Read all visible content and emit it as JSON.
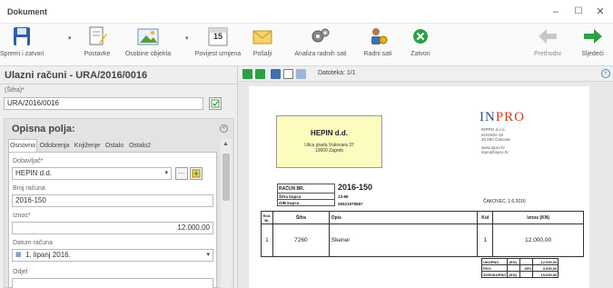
{
  "window": {
    "title": "Dokument"
  },
  "toolbar": {
    "save_close": "Spremi i zatvori",
    "settings": "Postavke",
    "personal_objects": "Osobine objekta",
    "change_history": "Povijest izmjena",
    "send": "Pošalji",
    "work_hours_analysis": "Analiza radnih sati",
    "work_hours": "Radni sati",
    "close": "Zatvori",
    "previous": "Prethodni",
    "next": "Sljedeći",
    "history_badge": "15"
  },
  "left": {
    "title": "Ulazni računi - URA/2016/0016",
    "code_label": "(Šifra)*",
    "code_value": "URA/2016/0016",
    "section_title": "Opisna polja:",
    "tabs": [
      "Osnovno",
      "Odobrenja",
      "Knjiženje",
      "Ostalo",
      "Ostalo2"
    ],
    "supplier_label": "Dobavljač*",
    "supplier_value": "HEPIN d.d.",
    "invoice_no_label": "Broj računa",
    "invoice_no_value": "2016-150",
    "amount_label": "Iznos*",
    "amount_value": "12.000,00",
    "date_label": "Datum računa",
    "date_value": "1. lipanj 2016.",
    "department_label": "Odjel"
  },
  "viewer": {
    "files_label": "Datoteka: 1/1"
  },
  "invoice": {
    "supplier_name": "HEPIN d.d.",
    "supplier_address_1": "Ulica grada Vukovara 37",
    "supplier_address_2": "10000 Zagreb",
    "logo_in": "IN",
    "logo_pro": "PRO",
    "company_line_1": "INPRO d.o.o.",
    "company_line_2": "M.Krleže 28",
    "company_line_3": "40 000 Čakovec",
    "company_line_4": "www.inpro.hr",
    "company_line_5": "inpro@inpro.hr",
    "racun_label": "RAČUN BR.",
    "racun_value": "2016-150",
    "sifra_kupca_label": "Šifra kupca",
    "sifra_kupca_value": "13-89",
    "oib_label": "OIB kupca",
    "oib_value": "26521978587",
    "place_date": "ČAKOVEC, 1.6.2016",
    "columns": [
      "Red. Br.",
      "Šifra",
      "Opis",
      "Kol",
      "Iznos (KN)"
    ],
    "rows": [
      {
        "no": "1",
        "code": "7260",
        "desc": "Skener",
        "qty": "1",
        "amount": "12.000,00"
      }
    ],
    "totals": [
      {
        "label": "UKUPNO",
        "unit": "(KN)",
        "pct": "",
        "value": "12.000,00"
      },
      {
        "label": "PDV:",
        "unit": "",
        "pct": "25%",
        "value": "3.000,00"
      },
      {
        "label": "SVEUKUPNO",
        "unit": "(KN)",
        "pct": "",
        "value": "15.000,00"
      }
    ]
  },
  "colors": {
    "accent_green": "#2ea043",
    "logo_blue": "#2a4a7f",
    "logo_red": "#d23a2a",
    "invoice_yellow": "#fdfcbf"
  }
}
